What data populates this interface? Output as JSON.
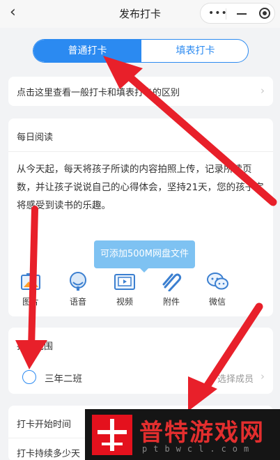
{
  "header": {
    "title": "发布打卡",
    "back_icon": "back-chevron-icon",
    "menu_icon": "more-dots-icon",
    "minimize_icon": "minimize-icon",
    "close_icon": "target-close-icon"
  },
  "tabs": [
    {
      "label": "普通打卡",
      "active": true
    },
    {
      "label": "填表打卡",
      "active": false
    }
  ],
  "info_row": {
    "text": "点击这里查看一般打卡和填表打卡的区别"
  },
  "reading": {
    "title": "每日阅读",
    "body": "从今天起，每天将孩子所读的内容拍照上传，记录所读页数，并让孩子说说自己的心得体会，坚持21天，您的孩子定将感受到读书的乐趣。"
  },
  "tooltip": {
    "text": "可添加500M网盘文件"
  },
  "tools": [
    {
      "label": "图片",
      "icon": "image-icon"
    },
    {
      "label": "语音",
      "icon": "voice-icon"
    },
    {
      "label": "视频",
      "icon": "video-icon"
    },
    {
      "label": "附件",
      "icon": "attachment-icon"
    },
    {
      "label": "微信",
      "icon": "wechat-icon"
    }
  ],
  "scope": {
    "title": "打卡范围",
    "class_name": "三年二班",
    "select_label": "选择成员"
  },
  "timing": {
    "start_label": "打卡开始时间",
    "duration_label": "打卡持续多少天"
  },
  "watermark": {
    "name": "普特游戏网",
    "domain": "ptbwcl.com"
  },
  "colors": {
    "accent": "#2b8af1",
    "tooltip": "#7ec2f2",
    "arrow": "#e8202a"
  }
}
